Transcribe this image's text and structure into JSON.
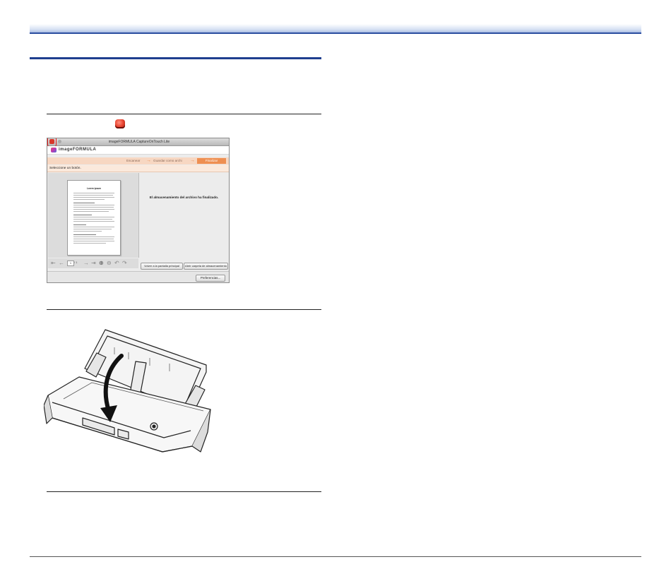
{
  "header": {
    "accent_color": "#2b4ea0"
  },
  "inline_icon": {
    "name": "captureontouch-lite-icon"
  },
  "app_window": {
    "title": "imageFORMULA CaptureOnTouch Lite",
    "brand": "imageFORMULA",
    "steps": [
      "Escanear",
      "Guardar como archi",
      "Finalizar"
    ],
    "instruction": "Seleccione un botón.",
    "thumbnail_title": "Lorem ipsum",
    "current_page": "1",
    "total_pages": "/ 1",
    "message": "El almacenamiento del archivo ha finalizado.",
    "buttons": {
      "back_to_main": "Volver a la pantalla principal",
      "open_folder": "Abrir carpeta de almacenamiento",
      "preferences": "Preferencias..."
    },
    "highlight_color": "#e21a1a",
    "step_active_color": "#ee8f52"
  },
  "illustration": {
    "name": "scanner-closing-feed-tray",
    "arrow": "curved-down-arrow-icon"
  }
}
